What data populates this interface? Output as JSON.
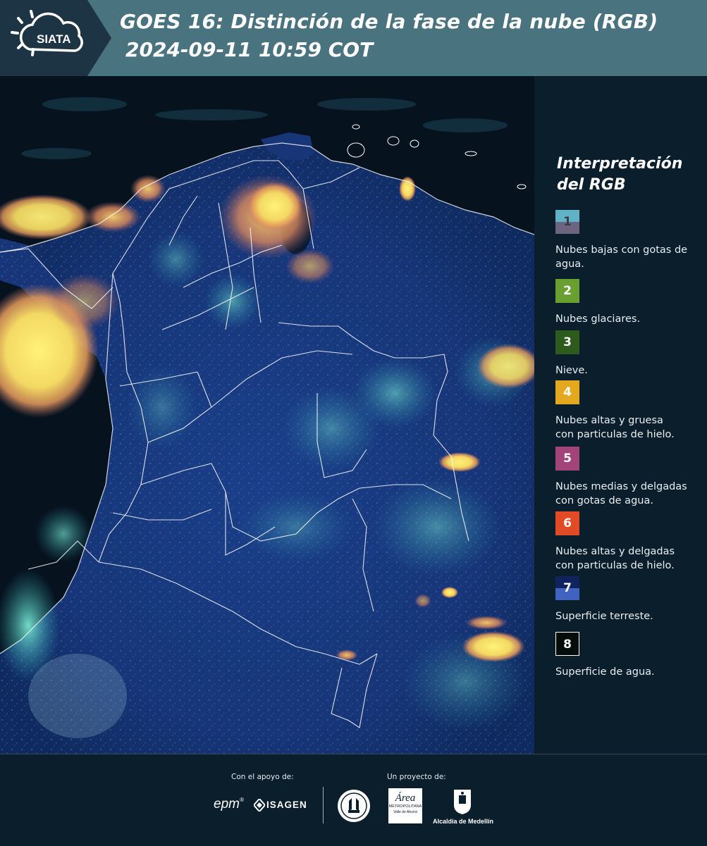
{
  "header": {
    "title_line1": "GOES 16: Distinción de la fase de la nube (RGB)",
    "title_line2": "2024-09-11 10:59 COT",
    "logo_text": "SIATA"
  },
  "legend": {
    "title_line1": "Interpretación",
    "title_line2": "del RGB",
    "items": [
      {
        "number": "1",
        "label_line1": "Nubes bajas con gotas de",
        "label_line2": "agua.",
        "color_top": "#5fb3c4",
        "color_bottom": "#6b6582"
      },
      {
        "number": "2",
        "label_line1": "Nubes glaciares.",
        "label_line2": "",
        "color_top": "#6aa032",
        "color_bottom": "#6aa032"
      },
      {
        "number": "3",
        "label_line1": "Nieve.",
        "label_line2": "",
        "color_top": "#2e5a1d",
        "color_bottom": "#2e5a1d"
      },
      {
        "number": "4",
        "label_line1": "Nubes altas y gruesa",
        "label_line2": "con particulas de hielo.",
        "color_top": "#e3a81e",
        "color_bottom": "#e3a81e"
      },
      {
        "number": "5",
        "label_line1": "Nubes medias y delgadas",
        "label_line2": "con gotas de agua.",
        "color_top": "#a2447a",
        "color_bottom": "#a2447a"
      },
      {
        "number": "6",
        "label_line1": "Nubes altas y delgadas",
        "label_line2": "con particulas de hielo.",
        "color_top": "#e04a25",
        "color_bottom": "#e04a25"
      },
      {
        "number": "7",
        "label_line1": "Superficie terreste.",
        "label_line2": "",
        "color_top": "#10235e",
        "color_bottom": "#3f63bf"
      },
      {
        "number": "8",
        "label_line1": "Superficie de agua.",
        "label_line2": "",
        "color_top": "#050d0a",
        "color_bottom": "#050d0a"
      }
    ]
  },
  "footer": {
    "support_caption": "Con el apoyo de:",
    "project_caption": "Un proyecto de:",
    "logos": {
      "epm": "epm",
      "isagen": "ISAGEN",
      "area_metro_line1": "Área",
      "area_metro_line2": "METROPOLITANA",
      "area_metro_line3": "Valle de Aburrá",
      "alcaldia": "Alcaldía de Medellín"
    }
  },
  "colors": {
    "header_bg": "#4a7380",
    "page_bg": "#0b1e2b",
    "land": "#163a7a",
    "ocean": "#06131f",
    "cloud_yellow": "#f5e86a",
    "cloud_orange": "#e8a060",
    "cloud_cyan": "#5ee8c8"
  }
}
